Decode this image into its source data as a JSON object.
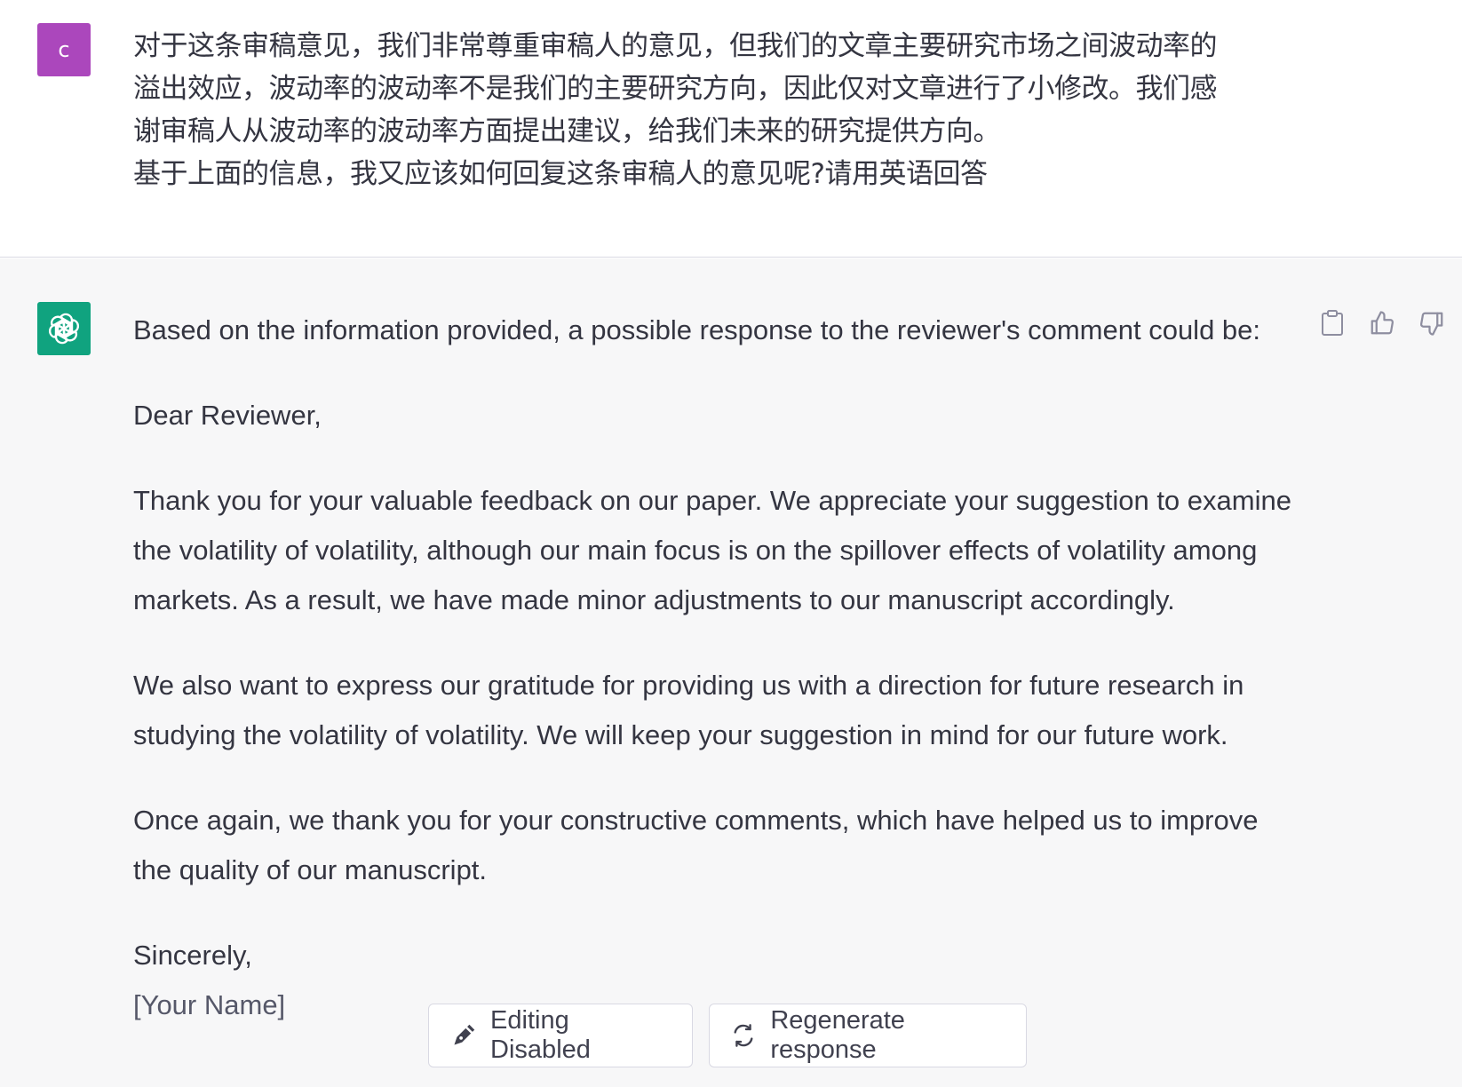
{
  "user_message": {
    "avatar_initial": "c",
    "lines": [
      "对于这条审稿意见，我们非常尊重审稿人的意见，但我们的文章主要研究市场之间波动率的",
      "溢出效应，波动率的波动率不是我们的主要研究方向，因此仅对文章进行了小修改。我们感",
      "谢审稿人从波动率的波动率方面提出建议，给我们未来的研究提供方向。",
      "基于上面的信息，我又应该如何回复这条审稿人的意见呢?请用英语回答"
    ]
  },
  "assistant_message": {
    "intro": "Based on the information provided, a possible response to the reviewer's comment could be:",
    "greeting": "Dear Reviewer,",
    "paragraph_1": "Thank you for your valuable feedback on our paper. We appreciate your suggestion to examine the volatility of volatility, although our main focus is on the spillover effects of volatility among markets. As a result, we have made minor adjustments to our manuscript accordingly.",
    "paragraph_2": "We also want to express our gratitude for providing us with a direction for future research in studying the volatility of volatility. We will keep your suggestion in mind for our future work.",
    "paragraph_3": "Once again, we thank you for your constructive comments, which have helped us to improve the quality of our manuscript.",
    "closing": "Sincerely,",
    "signature": "[Your Name]"
  },
  "actions": {
    "copy_icon": "clipboard-icon",
    "like_icon": "thumbs-up-icon",
    "dislike_icon": "thumbs-down-icon"
  },
  "buttons": {
    "editing_disabled": "Editing Disabled",
    "regenerate": "Regenerate response"
  },
  "colors": {
    "user_avatar_bg": "#ab47bc",
    "assistant_avatar_bg": "#10a37f",
    "assistant_bg": "#f7f7f8",
    "text": "#343541"
  }
}
